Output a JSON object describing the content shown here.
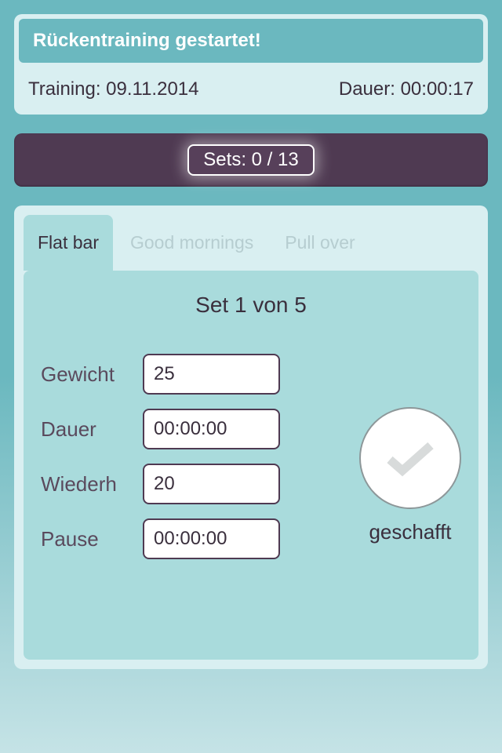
{
  "header": {
    "title": "Rückentraining gestartet!",
    "training_label": "Training:",
    "training_date": "09.11.2014",
    "duration_label": "Dauer:",
    "duration_value": "00:00:17"
  },
  "sets_bar": {
    "label": "Sets:",
    "current": "0",
    "total": "13",
    "text": "Sets: 0 / 13"
  },
  "tabs": [
    {
      "label": "Flat bar",
      "active": true
    },
    {
      "label": "Good mornings",
      "active": false
    },
    {
      "label": "Pull over",
      "active": false
    }
  ],
  "set_panel": {
    "title": "Set 1 von 5",
    "fields": {
      "weight_label": "Gewicht",
      "weight_value": "25",
      "duration_label": "Dauer",
      "duration_value": "00:00:00",
      "reps_label": "Wiederh",
      "reps_value": "20",
      "pause_label": "Pause",
      "pause_value": "00:00:00"
    },
    "done_label": "geschafft"
  }
}
